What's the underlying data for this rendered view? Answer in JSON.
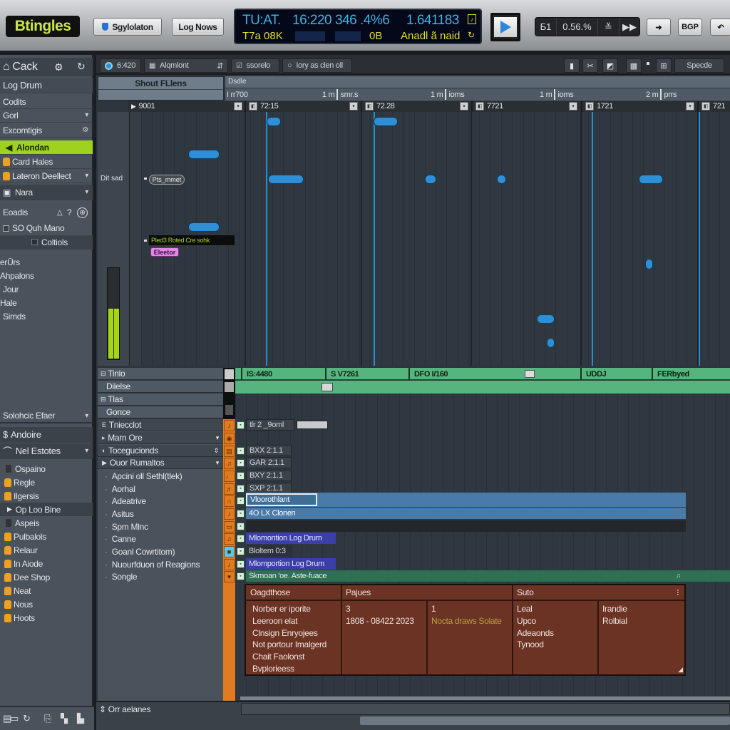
{
  "app": {
    "logo": "Btingles",
    "buttons": [
      {
        "label": "Sgylolaton",
        "icon": "shield-icon"
      },
      {
        "label": "Log Nows"
      }
    ]
  },
  "lcd": {
    "row1": [
      "TU:AT.",
      "16:220",
      "346 .4%6",
      "1.641183"
    ],
    "row2": [
      "T7a 08K",
      "0B",
      "Anadl ã naid"
    ],
    "side_icons": [
      "note-icon",
      "loop-icon"
    ]
  },
  "transport": {
    "play_icon": "play-icon",
    "items": [
      "Ƃ1",
      "0.56.%",
      "≚",
      "▶▶"
    ],
    "extra_buttons": [
      "➜",
      "BGP",
      "↶"
    ]
  },
  "sidebar": {
    "header": {
      "label": "Cack",
      "icons": [
        "home-icon",
        "gear-icon",
        "refresh-icon"
      ]
    },
    "instrument": "Log Drum",
    "rows": [
      {
        "label": "Codits"
      },
      {
        "label": "Gorl",
        "chevron": true
      },
      {
        "label": "Excomtigis",
        "icon": "settings-icon"
      },
      {
        "label": "Alondan",
        "selected": true
      },
      {
        "label": "Card Hales",
        "icon": "folder-icon"
      },
      {
        "label": "Lateron Deellect",
        "chevron": true
      },
      {
        "label": "Nara",
        "chevron": true
      }
    ],
    "loads": {
      "label": "Eoadis",
      "icons": [
        "up-icon",
        "pin-icon",
        "add-icon"
      ]
    },
    "checkbox_label": "SO Quh Mano",
    "controls_label": "Coltiols",
    "plain_items": [
      "erŪrs",
      "Ahpalons",
      "Jour",
      "Hale",
      "Simds"
    ],
    "sample_effects": "Solohcic Efaer",
    "andoire": "Andoire",
    "estates": "Nel Estotes",
    "files": [
      {
        "label": "Ospaino",
        "type": "doc"
      },
      {
        "label": "Regle",
        "type": "folder"
      },
      {
        "label": "Ilgersis",
        "type": "folder"
      },
      {
        "label": "Op Loo Bine",
        "type": "expand",
        "selected": true
      },
      {
        "label": "Aspeis",
        "type": "doc"
      },
      {
        "label": "Pulbalols",
        "type": "folder"
      },
      {
        "label": "Relaur",
        "type": "folder"
      },
      {
        "label": "In Aiode",
        "type": "folder"
      },
      {
        "label": "Dee Shop",
        "type": "folder"
      },
      {
        "label": "Neat",
        "type": "folder"
      },
      {
        "label": "Nous",
        "type": "folder"
      },
      {
        "label": "Hoots",
        "type": "folder"
      }
    ],
    "bottom_icons": [
      "list-icon",
      "window-icon",
      "loop-icon",
      "export-icon",
      "split-icon",
      "folder-icon"
    ]
  },
  "toolbar2": {
    "time": "6:420",
    "section": "Alqmlont",
    "snap": "ssorelo",
    "search": "Iory as clen oll",
    "label_right": "Specde",
    "icons": [
      "save-icon",
      "cut-icon",
      "crop-icon",
      "grid-icon",
      "table-icon"
    ]
  },
  "ruler": {
    "head_label": "Shout FLlens",
    "top_label": "Dsdle",
    "marks": [
      {
        "left": "I rr700",
        "right": "1 m"
      },
      {
        "left": "smr.s",
        "right": "1 m"
      },
      {
        "left": "ioms",
        "right": "1 m"
      },
      {
        "left": "ioms",
        "right": "2 m"
      },
      {
        "left": "prrs"
      }
    ]
  },
  "clips": [
    {
      "label": "9001",
      "icon": "play-icon"
    },
    {
      "label": "72:15"
    },
    {
      "label": "72.28"
    },
    {
      "label": "7721"
    },
    {
      "label": "1721"
    },
    {
      "label": "721"
    }
  ],
  "piano_roll": {
    "row_label": "Dit sad",
    "note_tag": "Pts_mmet",
    "hint": "Pled3 Roted Cre sohk",
    "pink_tag": "Eleetor",
    "meter_level": 0.55
  },
  "lanes": {
    "headers": [
      {
        "label": "Tinlo",
        "expand": true
      },
      {
        "label": "Dilelse"
      },
      {
        "label": "Tlas",
        "expand": true
      },
      {
        "label": "Gonce"
      }
    ],
    "markers": [
      "IS:4480",
      "S V7261",
      "DFO I/160",
      "UDDJ",
      "FERbyed"
    ]
  },
  "tracks": {
    "list": [
      {
        "label": "Tniecclot",
        "hdr": true
      },
      {
        "label": "Marn Ore",
        "hdr": true,
        "chevron": true
      },
      {
        "label": "Tocegucionds",
        "hdr": true,
        "chevron": true
      },
      {
        "label": "Ouor Rumaltos",
        "hdr": true,
        "chevron": true
      },
      {
        "label": "Apcini oll Sethl(tlek)"
      },
      {
        "label": "Aorhal"
      },
      {
        "label": "Adeatrive"
      },
      {
        "label": "Asitus"
      },
      {
        "label": "Spm Mlnc"
      },
      {
        "label": "Canne"
      },
      {
        "label": "Goanl Cowrtitom)"
      },
      {
        "label": "Nuourfduon of Reagions"
      },
      {
        "label": "Songle"
      }
    ],
    "clips": [
      {
        "label": "tlr 2 _9oml",
        "style": "dark",
        "field": true
      },
      {
        "label": ""
      },
      {
        "label": "BXX    2:1.1",
        "style": "dark"
      },
      {
        "label": "GAR    2:1.1",
        "style": "dark"
      },
      {
        "label": "BXY    2:1.1",
        "style": "dark"
      },
      {
        "label": "SXP    2:1.1",
        "style": "dark"
      },
      {
        "label": "Vloorothlant",
        "style": "selected"
      },
      {
        "label": "4O LX Clonen",
        "style": "bluebar"
      },
      {
        "label": "",
        "style": "darkbar"
      },
      {
        "label": "Mlomontion  Log Drum",
        "style": "purple"
      },
      {
        "label": "Bloltem  0:3",
        "style": "plain"
      },
      {
        "label": "Mlomportion  Log Drum",
        "style": "purple"
      },
      {
        "label": "Skmoan 'oe. Aste-fuace",
        "style": "green"
      }
    ]
  },
  "info_panel": {
    "headers": [
      "Oagdthose",
      "Pajues",
      "Suto"
    ],
    "col1": [
      "Norber er iporite",
      "Leeroon elat",
      "Clnsign Enryojees",
      "Not portour Imalgerd",
      "Chait Faolonst",
      "Bvplorieess"
    ],
    "col2": [
      "3",
      "1808 - 08422 2023"
    ],
    "col3": [
      "1",
      "Nocta draws Solate"
    ],
    "col4": [
      "Leal",
      "Upco",
      "Adeaonds",
      "Tynood"
    ],
    "col5": [
      "Irandie",
      "Rolbial"
    ],
    "col3_color": "#b8a040"
  },
  "bottom": {
    "label": "Orr aelanes"
  },
  "colors": {
    "accent_green": "#9fd21e",
    "note_blue": "#2e8fd6",
    "lane_green": "#56b57e",
    "orange": "#e07b1f",
    "panel_brown": "#6b3324",
    "lcd_blue": "#3ab4e8",
    "lcd_yellow": "#e3dd2f"
  }
}
